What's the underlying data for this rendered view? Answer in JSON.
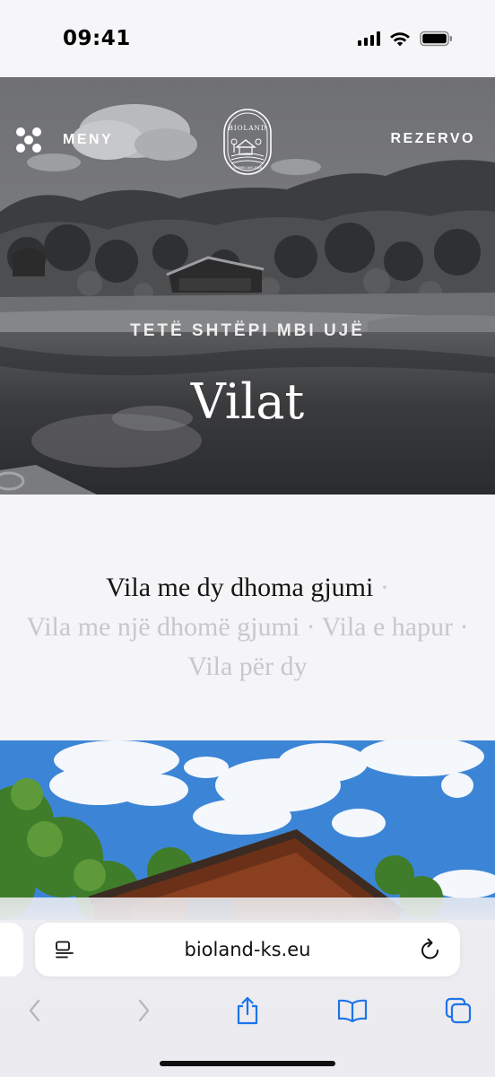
{
  "status_bar": {
    "time": "09:41"
  },
  "header": {
    "menu_label": "MENY",
    "reserve_label": "REZERVO",
    "logo": {
      "brand": "BIOLAND",
      "tagline": "THEMELUAR 2020"
    }
  },
  "hero": {
    "subtitle": "TETË SHTËPI MBI UJË",
    "title": "Vilat"
  },
  "villa_tabs": {
    "items": [
      {
        "label": "Vila me dy dhoma gjumi",
        "active": true
      },
      {
        "label": "Vila me një dhomë gjumi",
        "active": false
      },
      {
        "label": "Vila e hapur",
        "active": false
      },
      {
        "label": "Vila për dy",
        "active": false
      }
    ],
    "separator": "·"
  },
  "browser": {
    "url": "bioland-ks.eu",
    "icons": [
      "reader-icon",
      "reload-icon",
      "back-icon",
      "forward-icon",
      "share-icon",
      "bookmarks-icon",
      "tabs-icon"
    ],
    "accent_color": "#1e73e8",
    "disabled_color": "#b6b8bd"
  }
}
